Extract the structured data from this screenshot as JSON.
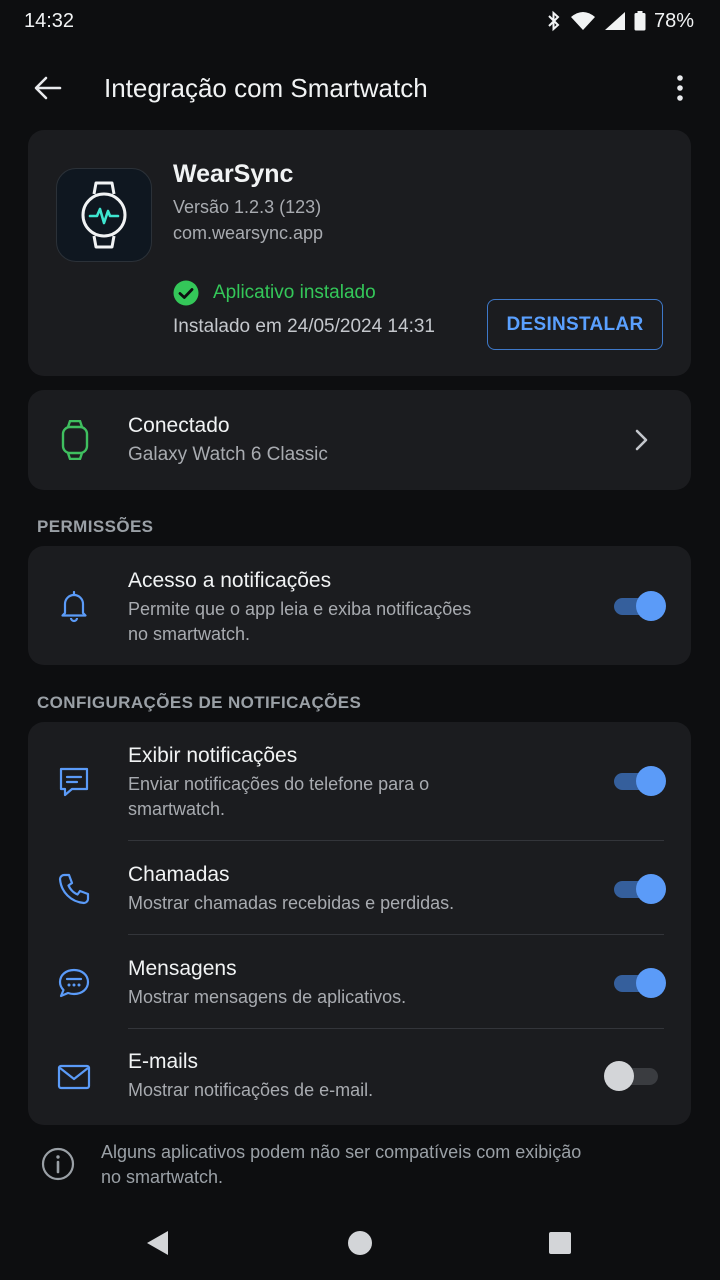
{
  "status_bar": {
    "time": "14:32",
    "battery": "78%",
    "icons": [
      "bluetooth-icon",
      "wifi-icon",
      "signal-icon",
      "battery-icon"
    ]
  },
  "app_bar": {
    "title": "Integração com Smartwatch",
    "back_icon": "arrow-left-icon",
    "more_icon": "more-vert-icon"
  },
  "app_info": {
    "name": "WearSync",
    "version": "Versão 1.2.3 (123)",
    "package": "com.wearsync.app",
    "status": "Aplicativo instalado",
    "installed_date": "Instalado em 24/05/2024 14:31",
    "uninstall_label": "DESINSTALAR",
    "icon": "smartwatch-heartbeat-icon"
  },
  "device": {
    "status": "Conectado",
    "name": "Galaxy Watch 6 Classic",
    "icon": "watch-icon"
  },
  "sections": {
    "permissions": "PERMISSÕES",
    "notification_settings": "CONFIGURAÇÕES DE NOTIFICAÇÕES"
  },
  "permissions": [
    {
      "title": "Acesso a notificações",
      "desc_line1": "Permite que o app leia e exiba notificações",
      "desc_line2": "no smartwatch.",
      "icon": "bell-icon",
      "enabled": true
    }
  ],
  "notification_settings": [
    {
      "title": "Exibir notificações",
      "desc_line1": "Enviar notificações do telefone para o",
      "desc_line2": "smartwatch.",
      "icon": "message-square-icon",
      "enabled": true
    },
    {
      "title": "Chamadas",
      "desc_line1": "Mostrar chamadas recebidas e perdidas.",
      "icon": "phone-icon",
      "enabled": true
    },
    {
      "title": "Mensagens",
      "desc_line1": "Mostrar mensagens de aplicativos.",
      "icon": "chat-bubble-icon",
      "enabled": true
    },
    {
      "title": "E-mails",
      "desc_line1": "Mostrar notificações de e-mail.",
      "icon": "mail-icon",
      "enabled": false
    }
  ],
  "footer": {
    "line1": "Alguns aplicativos podem não ser compatíveis com exibição",
    "line2": "no smartwatch.",
    "icon": "info-icon"
  },
  "colors": {
    "background": "#0d0e10",
    "card": "#1b1c1f",
    "accent": "#5b9bf8",
    "success": "#34c759",
    "device_green": "#3fbf5f"
  }
}
